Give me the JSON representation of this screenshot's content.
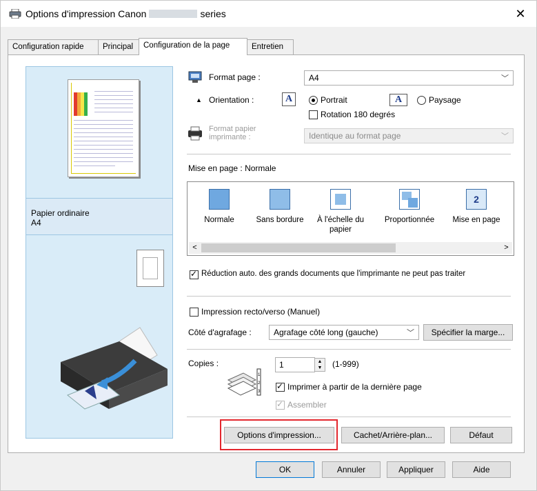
{
  "window": {
    "title_prefix": "Options d'impression Canon",
    "title_suffix": "series",
    "close_glyph": "✕",
    "icon": "printer-icon"
  },
  "tabs": [
    {
      "label": "Configuration rapide",
      "active": false
    },
    {
      "label": "Principal",
      "active": false
    },
    {
      "label": "Configuration de la page",
      "active": true
    },
    {
      "label": "Entretien",
      "active": false
    }
  ],
  "preview": {
    "media_type": "Papier ordinaire",
    "media_size": "A4",
    "colors": {
      "bar1": "#e23b2e",
      "bar2": "#f2a93b",
      "bar3": "#f5e54a",
      "bar4": "#37b04a"
    }
  },
  "page_size": {
    "label": "Format page :",
    "value": "A4"
  },
  "orientation": {
    "label": "Orientation :",
    "portrait": "Portrait",
    "landscape": "Paysage",
    "selected": "Portrait",
    "rotate_label": "Rotation 180 degrés",
    "rotate_checked": false
  },
  "printer_paper_size": {
    "label_line1": "Format papier",
    "label_line2": "imprimante :",
    "value": "Identique au format page"
  },
  "layout": {
    "label": "Mise en page :",
    "current": "Normale",
    "items": [
      {
        "label_line1": "Normale",
        "label_line2": "",
        "icon": "normal-layout-icon",
        "selected": true
      },
      {
        "label_line1": "Sans bordure",
        "label_line2": "",
        "icon": "borderless-layout-icon",
        "selected": false
      },
      {
        "label_line1": "À l'échelle du",
        "label_line2": "papier",
        "icon": "fit-to-page-icon",
        "selected": false
      },
      {
        "label_line1": "Proportionnée",
        "label_line2": "",
        "icon": "scaled-layout-icon",
        "selected": false
      },
      {
        "label_line1": "Mise en page",
        "label_line2": "",
        "icon": "page-layout-icon",
        "selected": false
      }
    ],
    "page_layout_number": "2",
    "scroll_left": "<",
    "scroll_right": ">"
  },
  "auto_reduce": {
    "label": "Réduction auto. des grands documents que l'imprimante ne peut pas traiter",
    "checked": true
  },
  "duplex": {
    "label": "Impression recto/verso (Manuel)",
    "checked": false
  },
  "stapling": {
    "label": "Côté d'agrafage :",
    "value": "Agrafage côté long (gauche)",
    "margin_button": "Spécifier la marge..."
  },
  "copies": {
    "label": "Copies :",
    "value": "1",
    "range": "(1-999)",
    "last_page_label": "Imprimer à partir de la dernière page",
    "last_page_checked": true,
    "collate_label": "Assembler",
    "collate_checked": true
  },
  "buttons": {
    "print_options": "Options d'impression...",
    "stamp_background": "Cachet/Arrière-plan...",
    "defaults": "Défaut",
    "ok": "OK",
    "cancel": "Annuler",
    "apply": "Appliquer",
    "help": "Aide"
  }
}
